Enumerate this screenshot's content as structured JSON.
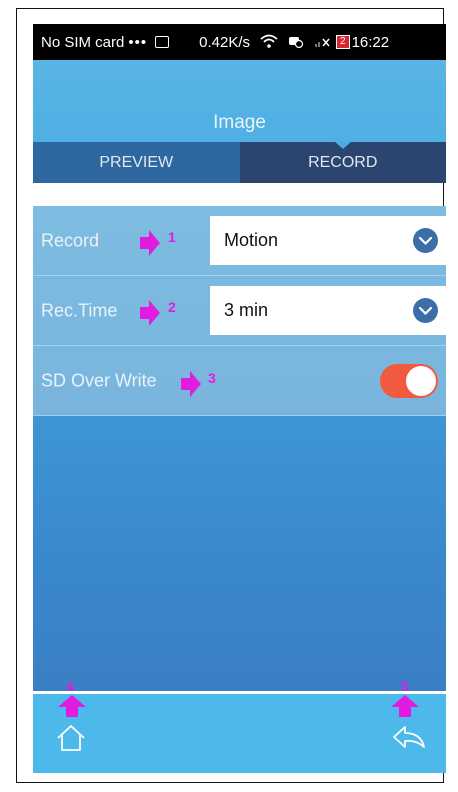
{
  "status_bar": {
    "carrier": "No SIM card",
    "dots": "•••",
    "speed": "0.42K/s",
    "battery": "2",
    "time": "16:22"
  },
  "header": {
    "title": "Image"
  },
  "tabs": [
    {
      "label": "PREVIEW",
      "active": false
    },
    {
      "label": "RECORD",
      "active": true
    }
  ],
  "settings": {
    "record": {
      "label": "Record",
      "value": "Motion"
    },
    "rec_time": {
      "label": "Rec.Time",
      "value": "3 min"
    },
    "sd_overwrite": {
      "label": "SD Over Write",
      "enabled": true
    }
  },
  "annotations": [
    "1",
    "2",
    "3",
    "4",
    "5"
  ],
  "icons": {
    "home": "home-icon",
    "back": "back-icon",
    "chevron": "chevron-down-icon",
    "wifi": "wifi-icon"
  },
  "colors": {
    "header": "#4aaee3",
    "tab_active": "#2b4470",
    "tab_inactive": "#2f67a0",
    "toggle_on": "#f15a3f",
    "annotation": "#e11ce0",
    "footer": "#4db8ea"
  }
}
